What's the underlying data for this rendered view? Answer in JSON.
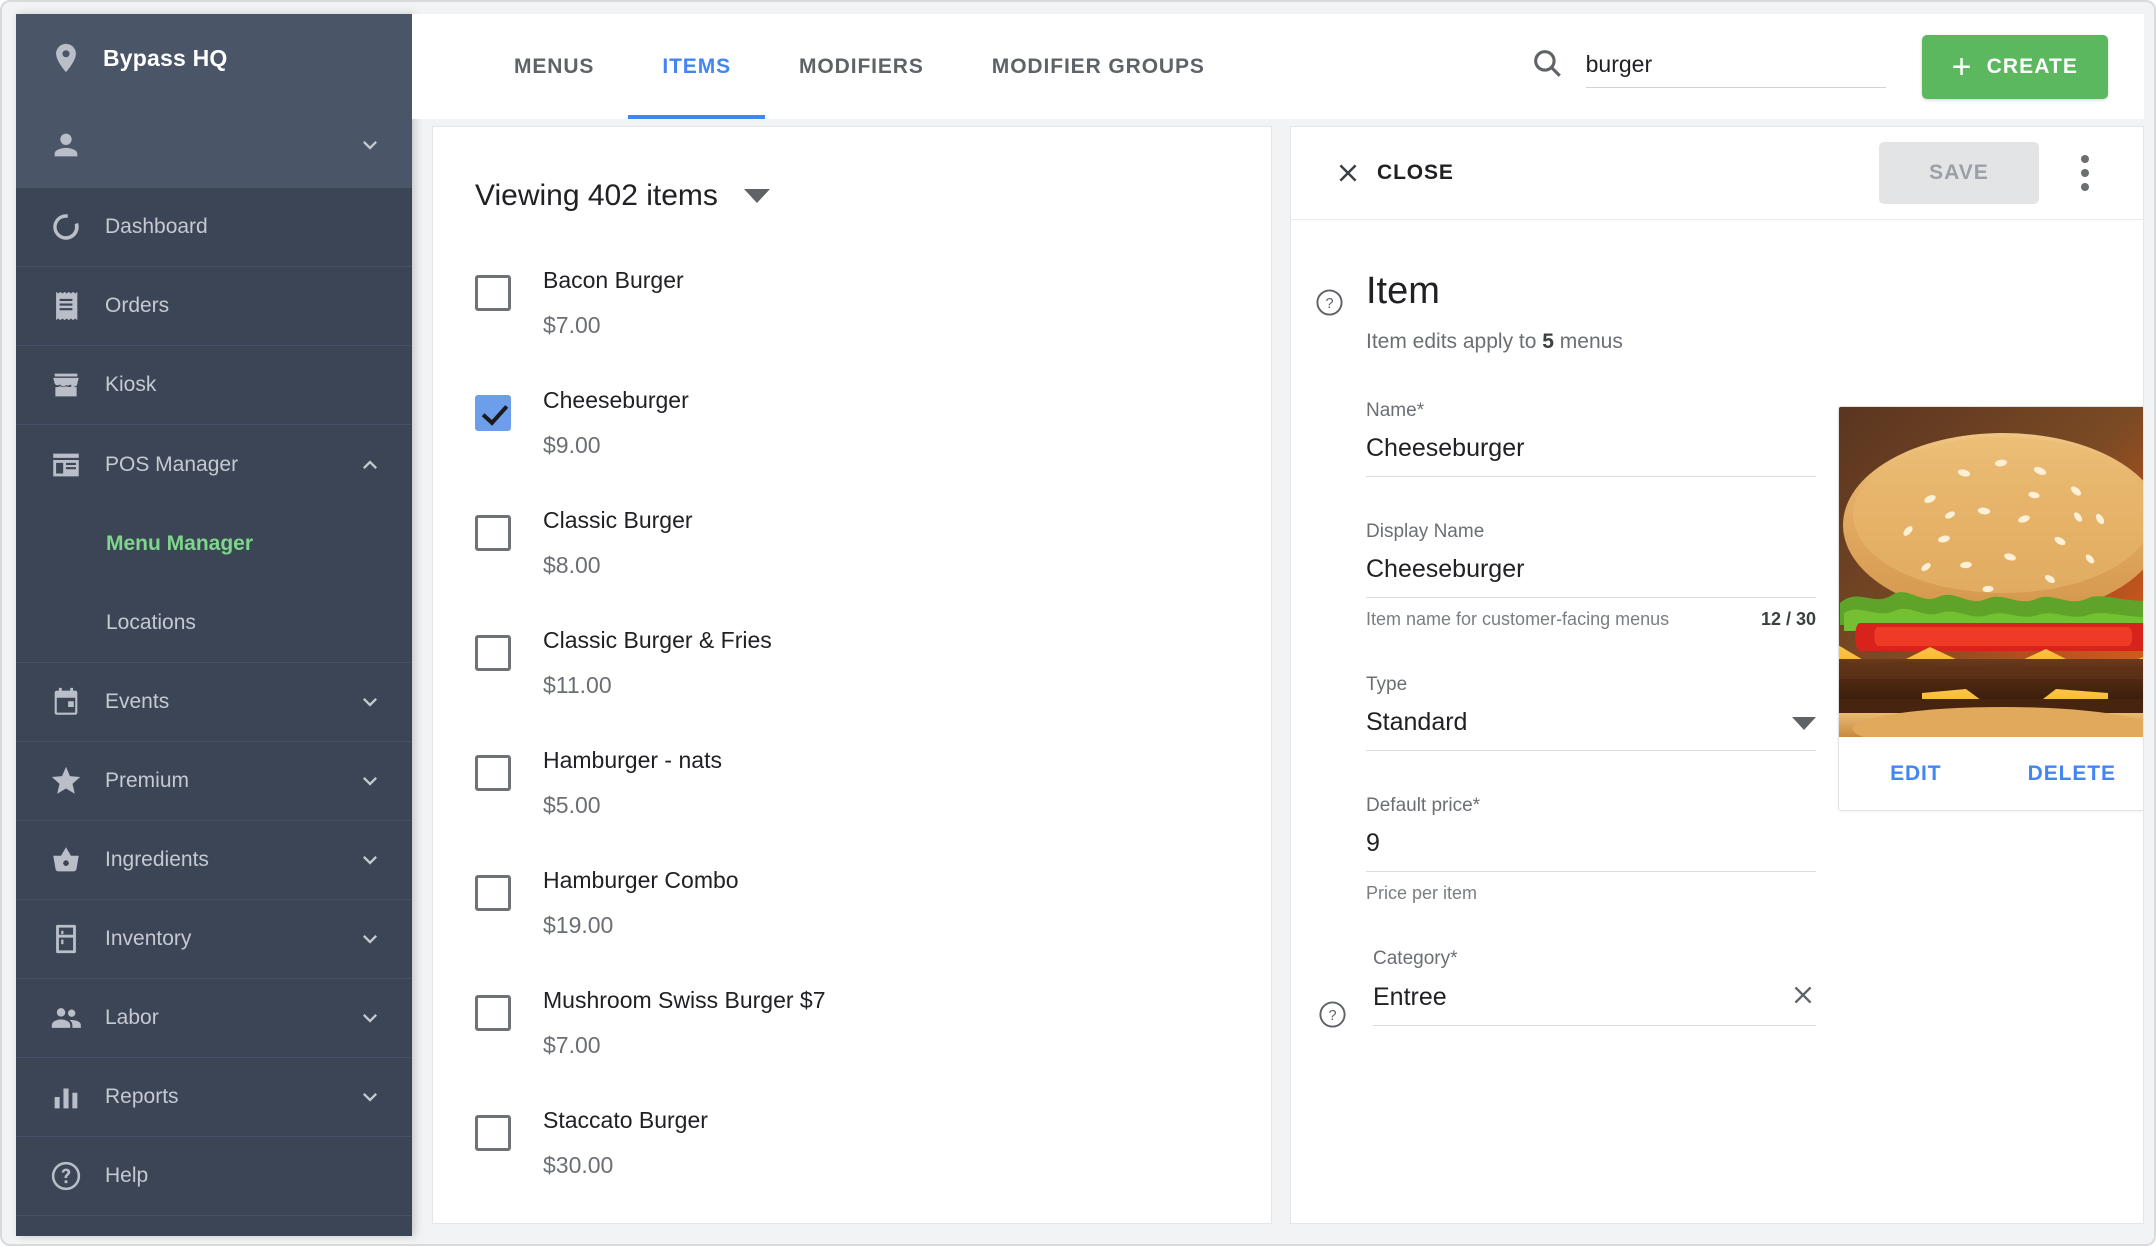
{
  "sidebar": {
    "brand": {
      "label": "Bypass HQ",
      "icon": "location-pin-icon"
    },
    "user": {
      "icon": "person-icon",
      "chevron": "chevron-down-icon"
    },
    "items": [
      {
        "label": "Dashboard",
        "icon": "dashboard-donut-icon",
        "expandable": false
      },
      {
        "label": "Orders",
        "icon": "receipt-icon",
        "expandable": false
      },
      {
        "label": "Kiosk",
        "icon": "storefront-icon",
        "expandable": false
      },
      {
        "label": "POS Manager",
        "icon": "pos-store-icon",
        "expandable": true,
        "expanded": true
      },
      {
        "label": "Events",
        "icon": "calendar-icon",
        "expandable": true,
        "expanded": false
      },
      {
        "label": "Premium",
        "icon": "star-icon",
        "expandable": true,
        "expanded": false
      },
      {
        "label": "Ingredients",
        "icon": "basket-icon",
        "expandable": true,
        "expanded": false
      },
      {
        "label": "Inventory",
        "icon": "fridge-icon",
        "expandable": true,
        "expanded": false
      },
      {
        "label": "Labor",
        "icon": "people-icon",
        "expandable": true,
        "expanded": false
      },
      {
        "label": "Reports",
        "icon": "bar-chart-icon",
        "expandable": true,
        "expanded": false
      },
      {
        "label": "Help",
        "icon": "help-circle-icon",
        "expandable": false
      }
    ],
    "pos_subitems": [
      {
        "label": "Menu Manager",
        "active": true
      },
      {
        "label": "Locations",
        "active": false
      }
    ],
    "colors": {
      "top_bg": "#4a5568",
      "nav_bg": "#3c4556",
      "active_green": "#7dd68a"
    }
  },
  "topbar": {
    "tabs": [
      {
        "label": "MENUS",
        "active": false
      },
      {
        "label": "ITEMS",
        "active": true
      },
      {
        "label": "MODIFIERS",
        "active": false
      },
      {
        "label": "MODIFIER GROUPS",
        "active": false
      }
    ],
    "search": {
      "value": "burger",
      "placeholder": "",
      "icon": "search-icon"
    },
    "create_label": "CREATE",
    "create_icon": "plus-icon",
    "accent": "#4285f4",
    "create_color": "#5cb85f"
  },
  "list_panel": {
    "viewing_label": "Viewing 402 items",
    "viewing_caret": "chevron-down-icon",
    "items": [
      {
        "name": "Bacon Burger",
        "price": "$7.00",
        "checked": false
      },
      {
        "name": "Cheeseburger",
        "price": "$9.00",
        "checked": true
      },
      {
        "name": "Classic Burger",
        "price": "$8.00",
        "checked": false
      },
      {
        "name": "Classic Burger & Fries",
        "price": "$11.00",
        "checked": false
      },
      {
        "name": "Hamburger - nats",
        "price": "$5.00",
        "checked": false
      },
      {
        "name": "Hamburger Combo",
        "price": "$19.00",
        "checked": false
      },
      {
        "name": "Mushroom Swiss Burger $7",
        "price": "$7.00",
        "checked": false
      },
      {
        "name": "Staccato Burger",
        "price": "$30.00",
        "checked": false
      }
    ]
  },
  "detail_panel": {
    "close_label": "CLOSE",
    "close_icon": "close-x-icon",
    "save_label": "SAVE",
    "kebab_icon": "more-vertical-icon",
    "title": "Item",
    "title_help_icon": "help-circle-icon",
    "subtitle_prefix": "Item edits apply to",
    "subtitle_count": "5",
    "subtitle_suffix": "menus",
    "fields": {
      "name": {
        "label": "Name",
        "required": "*",
        "value": "Cheeseburger"
      },
      "display_name": {
        "label": "Display Name",
        "required": "",
        "value": "Cheeseburger",
        "hint": "Item name for customer-facing menus",
        "counter": "12 / 30"
      },
      "type": {
        "label": "Type",
        "required": "",
        "value": "Standard",
        "caret": "chevron-down-icon"
      },
      "default_price": {
        "label": "Default price",
        "required": "*",
        "value": "9",
        "hint": "Price per item"
      },
      "category": {
        "label": "Category",
        "required": "*",
        "value": "Entree",
        "clear_icon": "close-x-icon",
        "help_icon": "help-circle-icon"
      }
    },
    "image_card": {
      "alt": "cheeseburger-photo",
      "edit_label": "EDIT",
      "delete_label": "DELETE",
      "link_color": "#4285f4"
    }
  }
}
